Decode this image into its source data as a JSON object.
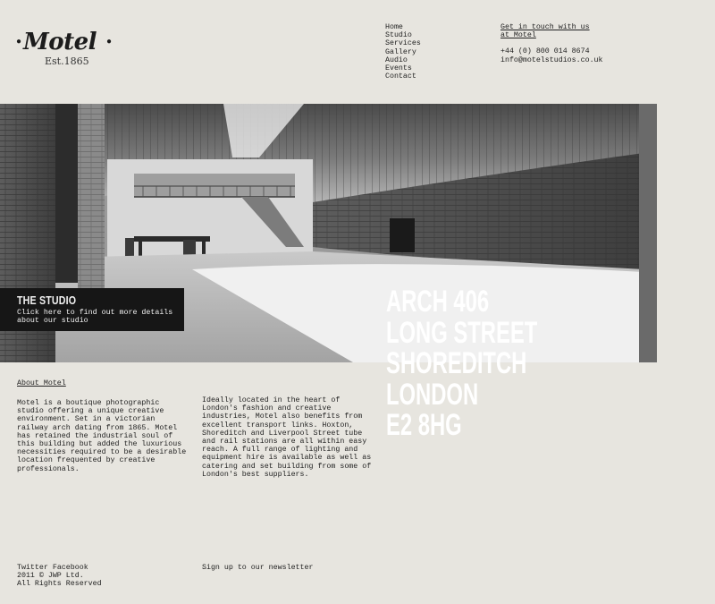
{
  "logo": {
    "wordmark": "Motel",
    "established": "Est.1865"
  },
  "nav": {
    "items": [
      "Home",
      "Studio",
      "Services",
      "Gallery",
      "Audio",
      "Events",
      "Contact"
    ]
  },
  "contact": {
    "cta_line1": "Get in touch with us",
    "cta_line2": "at Motel",
    "phone": "+44 (0) 800 014 8674",
    "email": "info@motelstudios.co.uk"
  },
  "hero": {
    "studio_title": "THE STUDIO",
    "studio_desc": "Click here to find out more details about our studio",
    "address": [
      "ARCH 406",
      "LONG STREET",
      "SHOREDITCH",
      "LONDON",
      "E2 8HG"
    ]
  },
  "about": {
    "heading": "About Motel",
    "col1": "Motel is a boutique photographic studio offering a unique creative environment. Set in a victorian railway arch dating from 1865. Motel has retained the industrial soul of this building but added the luxurious necessities required to be a desirable location frequented by creative professionals.",
    "col2": "Ideally located in the heart of London's fashion and creative industries, Motel also benefits from excellent transport links. Hoxton, Shoreditch and Liverpool Street tube and rail stations are all within easy reach. A full range of lighting and equipment hire is available as well as catering and set building from some of London's best suppliers."
  },
  "footer": {
    "twitter": "Twitter",
    "facebook": "Facebook",
    "copyright": "2011 © JWP Ltd.",
    "rights": "All Rights Reserved",
    "newsletter": "Sign up to our newsletter"
  }
}
